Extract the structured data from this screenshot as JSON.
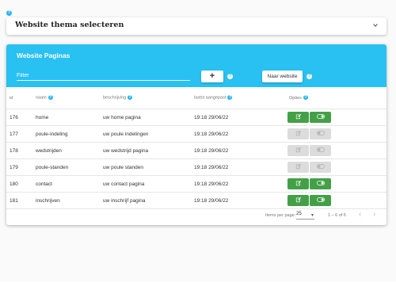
{
  "theme_section": {
    "help": "?",
    "title": "Website thema selecteren"
  },
  "pages_section": {
    "title": "Website Paginas",
    "filter_placeholder": "Filter",
    "add_label": "+",
    "add_help": "?",
    "website_button": "Naar website",
    "website_help": "?"
  },
  "table": {
    "columns": {
      "id": "id",
      "naam": "naam",
      "beschrijving": "beschrijving",
      "laatst_aangepast": "laatst aangepast",
      "opties": "Opties"
    },
    "column_help": "?",
    "rows": [
      {
        "id": "176",
        "naam": "home",
        "beschrijving": "uw home pagina",
        "datum": "19:18 29/06/22",
        "active": true
      },
      {
        "id": "177",
        "naam": "poule-indeling",
        "beschrijving": "uw poule indelingen",
        "datum": "19:18 29/06/22",
        "active": false
      },
      {
        "id": "178",
        "naam": "wedstrijden",
        "beschrijving": "uw wedstrijd pagina",
        "datum": "19:18 29/06/22",
        "active": false
      },
      {
        "id": "179",
        "naam": "poule-standen",
        "beschrijving": "uw poule standen",
        "datum": "19:18 29/06/22",
        "active": false
      },
      {
        "id": "180",
        "naam": "contact",
        "beschrijving": "uw contact pagina",
        "datum": "19:18 29/06/22",
        "active": true
      },
      {
        "id": "181",
        "naam": "inschrijven",
        "beschrijving": "uw inschrijf pagina",
        "datum": "19:18 29/06/22",
        "active": true
      }
    ]
  },
  "paginator": {
    "items_per_page_label": "Items per page:",
    "items_per_page": "25",
    "range": "1 – 6 of 6"
  },
  "colors": {
    "header": "#29c0f2",
    "active_button": "#43a047",
    "inactive_button": "#dcdcdc"
  },
  "icons": {
    "edit": "edit-icon",
    "toggle": "toggle-icon",
    "expand": "chevron-down-icon",
    "prev": "chevron-left-icon",
    "next": "chevron-right-icon"
  }
}
